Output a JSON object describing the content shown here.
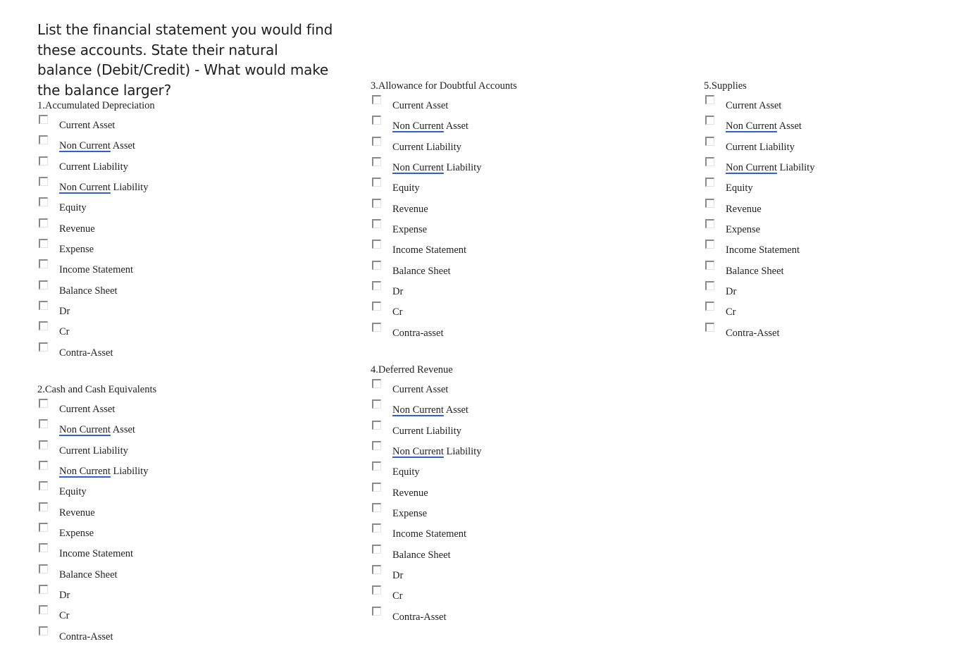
{
  "instructions": "List the financial statement you would find these accounts. State their natural balance (Debit/Credit) - What would make the balance larger?",
  "questions": [
    {
      "title": "1.Accumulated Depreciation",
      "options": [
        {
          "pre": "",
          "ul": "",
          "post": "Current Asset",
          "checked": false
        },
        {
          "pre": "",
          "ul": "Non Current",
          "post": " Asset",
          "checked": false
        },
        {
          "pre": "",
          "ul": "",
          "post": "Current Liability",
          "checked": false
        },
        {
          "pre": "",
          "ul": "Non Current",
          "post": " Liability",
          "checked": false
        },
        {
          "pre": "",
          "ul": "",
          "post": "Equity",
          "checked": false
        },
        {
          "pre": "",
          "ul": "",
          "post": "Revenue",
          "checked": false
        },
        {
          "pre": "",
          "ul": "",
          "post": "Expense",
          "checked": false
        },
        {
          "pre": "",
          "ul": "",
          "post": "Income Statement",
          "checked": false
        },
        {
          "pre": "",
          "ul": "",
          "post": "Balance Sheet",
          "checked": false
        },
        {
          "pre": "",
          "ul": "",
          "post": "Dr",
          "checked": false
        },
        {
          "pre": "",
          "ul": "",
          "post": "Cr",
          "checked": false
        },
        {
          "pre": "",
          "ul": "",
          "post": "Contra-Asset",
          "checked": false
        }
      ]
    },
    {
      "title": "2.Cash and Cash Equivalents",
      "options": [
        {
          "pre": "",
          "ul": "",
          "post": "Current Asset",
          "checked": false
        },
        {
          "pre": "",
          "ul": "Non Current",
          "post": " Asset",
          "checked": false
        },
        {
          "pre": "",
          "ul": "",
          "post": "Current Liability",
          "checked": false
        },
        {
          "pre": "",
          "ul": "Non Current",
          "post": " Liability",
          "checked": false
        },
        {
          "pre": "",
          "ul": "",
          "post": "Equity",
          "checked": false
        },
        {
          "pre": "",
          "ul": "",
          "post": "Revenue",
          "checked": false
        },
        {
          "pre": "",
          "ul": "",
          "post": "Expense",
          "checked": false
        },
        {
          "pre": "",
          "ul": "",
          "post": "Income Statement",
          "checked": false
        },
        {
          "pre": "",
          "ul": "",
          "post": "Balance Sheet",
          "checked": false
        },
        {
          "pre": "",
          "ul": "",
          "post": "Dr",
          "checked": false
        },
        {
          "pre": "",
          "ul": "",
          "post": "Cr",
          "checked": false
        },
        {
          "pre": "",
          "ul": "",
          "post": "Contra-Asset",
          "checked": false
        }
      ]
    },
    {
      "title": "3.Allowance for Doubtful Accounts",
      "options": [
        {
          "pre": "",
          "ul": "",
          "post": "Current Asset",
          "checked": false
        },
        {
          "pre": "",
          "ul": "Non Current",
          "post": " Asset",
          "checked": false
        },
        {
          "pre": "",
          "ul": "",
          "post": "Current Liability",
          "checked": false
        },
        {
          "pre": "",
          "ul": "Non Current",
          "post": " Liability",
          "checked": false
        },
        {
          "pre": "",
          "ul": "",
          "post": "Equity",
          "checked": false
        },
        {
          "pre": "",
          "ul": "",
          "post": "Revenue",
          "checked": false
        },
        {
          "pre": "",
          "ul": "",
          "post": "Expense",
          "checked": false
        },
        {
          "pre": "",
          "ul": "",
          "post": "Income Statement",
          "checked": false
        },
        {
          "pre": "",
          "ul": "",
          "post": "Balance Sheet",
          "checked": false
        },
        {
          "pre": "",
          "ul": "",
          "post": "Dr",
          "checked": false
        },
        {
          "pre": "",
          "ul": "",
          "post": "Cr",
          "checked": false
        },
        {
          "pre": "",
          "ul": "",
          "post": "Contra-asset",
          "checked": false
        }
      ]
    },
    {
      "title": "4.Deferred Revenue",
      "options": [
        {
          "pre": "",
          "ul": "",
          "post": "Current Asset",
          "checked": false
        },
        {
          "pre": "",
          "ul": "Non Current",
          "post": " Asset",
          "checked": false
        },
        {
          "pre": "",
          "ul": "",
          "post": "Current Liability",
          "checked": false
        },
        {
          "pre": "",
          "ul": "Non Current",
          "post": " Liability",
          "checked": false
        },
        {
          "pre": "",
          "ul": "",
          "post": "Equity",
          "checked": false
        },
        {
          "pre": "",
          "ul": "",
          "post": "Revenue",
          "checked": false
        },
        {
          "pre": "",
          "ul": "",
          "post": "Expense",
          "checked": false
        },
        {
          "pre": "",
          "ul": "",
          "post": "Income Statement",
          "checked": false
        },
        {
          "pre": "",
          "ul": "",
          "post": "Balance Sheet",
          "checked": false
        },
        {
          "pre": "",
          "ul": "",
          "post": "Dr",
          "checked": false
        },
        {
          "pre": "",
          "ul": "",
          "post": "Cr",
          "checked": false
        },
        {
          "pre": "",
          "ul": "",
          "post": "Contra-Asset",
          "checked": false
        }
      ]
    },
    {
      "title": "5.Supplies",
      "options": [
        {
          "pre": "",
          "ul": "",
          "post": "Current Asset",
          "checked": false
        },
        {
          "pre": "",
          "ul": "Non Current",
          "post": " Asset",
          "checked": false
        },
        {
          "pre": "",
          "ul": "",
          "post": "Current Liability",
          "checked": false
        },
        {
          "pre": "",
          "ul": "Non Current",
          "post": " Liability",
          "checked": false
        },
        {
          "pre": "",
          "ul": "",
          "post": "Equity",
          "checked": false
        },
        {
          "pre": "",
          "ul": "",
          "post": "Revenue",
          "checked": false
        },
        {
          "pre": "",
          "ul": "",
          "post": "Expense",
          "checked": false
        },
        {
          "pre": "",
          "ul": "",
          "post": "Income Statement",
          "checked": false
        },
        {
          "pre": "",
          "ul": "",
          "post": "Balance Sheet",
          "checked": false
        },
        {
          "pre": "",
          "ul": "",
          "post": "Dr",
          "checked": false
        },
        {
          "pre": "",
          "ul": "",
          "post": "Cr",
          "checked": false
        },
        {
          "pre": "",
          "ul": "",
          "post": "Contra-Asset",
          "checked": false
        }
      ]
    }
  ]
}
